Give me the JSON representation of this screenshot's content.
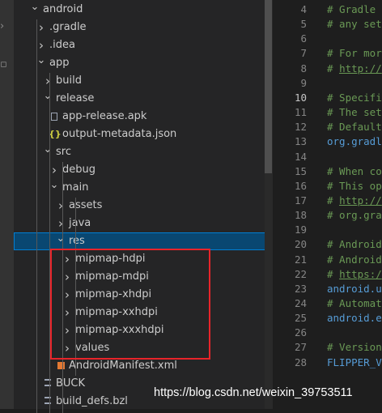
{
  "activity_bar": {
    "icons": [
      "chevron-right-icon",
      "extensions-icon"
    ]
  },
  "explorer": {
    "items": [
      {
        "label": "android",
        "type": "folder",
        "expanded": true
      },
      {
        "label": ".gradle",
        "type": "folder",
        "expanded": false
      },
      {
        "label": ".idea",
        "type": "folder",
        "expanded": false
      },
      {
        "label": "app",
        "type": "folder",
        "expanded": true
      },
      {
        "label": "build",
        "type": "folder",
        "expanded": false
      },
      {
        "label": "release",
        "type": "folder",
        "expanded": true
      },
      {
        "label": "app-release.apk",
        "type": "file"
      },
      {
        "label": "output-metadata.json",
        "type": "file",
        "icon_glyph": "{}"
      },
      {
        "label": "src",
        "type": "folder",
        "expanded": true
      },
      {
        "label": "debug",
        "type": "folder",
        "expanded": false
      },
      {
        "label": "main",
        "type": "folder",
        "expanded": true
      },
      {
        "label": "assets",
        "type": "folder",
        "expanded": false
      },
      {
        "label": "java",
        "type": "folder",
        "expanded": false
      },
      {
        "label": "res",
        "type": "folder",
        "expanded": true,
        "selected": true
      },
      {
        "label": "mipmap-hdpi",
        "type": "folder",
        "expanded": false
      },
      {
        "label": "mipmap-mdpi",
        "type": "folder",
        "expanded": false
      },
      {
        "label": "mipmap-xhdpi",
        "type": "folder",
        "expanded": false
      },
      {
        "label": "mipmap-xxhdpi",
        "type": "folder",
        "expanded": false
      },
      {
        "label": "mipmap-xxxhdpi",
        "type": "folder",
        "expanded": false
      },
      {
        "label": "values",
        "type": "folder",
        "expanded": false
      },
      {
        "label": "AndroidManifest.xml",
        "type": "file"
      },
      {
        "label": "BUCK",
        "type": "file"
      },
      {
        "label": "build_defs.bzl",
        "type": "file"
      }
    ]
  },
  "editor": {
    "current_line": "10",
    "lines": [
      {
        "num": "4",
        "text": "# Gradle",
        "kind": "comment"
      },
      {
        "num": "5",
        "text": "# any set",
        "kind": "comment"
      },
      {
        "num": "6",
        "text": "",
        "kind": "blank"
      },
      {
        "num": "7",
        "text": "# For mor",
        "kind": "comment"
      },
      {
        "num": "8",
        "text": "# http://",
        "kind": "link"
      },
      {
        "num": "9",
        "text": "",
        "kind": "blank"
      },
      {
        "num": "10",
        "text": "# Specifi",
        "kind": "comment"
      },
      {
        "num": "11",
        "text": "# The set",
        "kind": "comment"
      },
      {
        "num": "12",
        "text": "# Default",
        "kind": "comment"
      },
      {
        "num": "13",
        "text": "org.gradl",
        "kind": "key"
      },
      {
        "num": "14",
        "text": "",
        "kind": "blank"
      },
      {
        "num": "15",
        "text": "# When co",
        "kind": "comment"
      },
      {
        "num": "16",
        "text": "# This op",
        "kind": "comment"
      },
      {
        "num": "17",
        "text": "# http://",
        "kind": "link"
      },
      {
        "num": "18",
        "text": "# org.gra",
        "kind": "comment"
      },
      {
        "num": "19",
        "text": "",
        "kind": "blank"
      },
      {
        "num": "20",
        "text": "# Android",
        "kind": "comment"
      },
      {
        "num": "21",
        "text": "# Android",
        "kind": "comment"
      },
      {
        "num": "22",
        "text": "# https:/",
        "kind": "link"
      },
      {
        "num": "23",
        "text": "android.u",
        "kind": "key"
      },
      {
        "num": "24",
        "text": "# Automat",
        "kind": "comment"
      },
      {
        "num": "25",
        "text": "android.e",
        "kind": "key"
      },
      {
        "num": "26",
        "text": "",
        "kind": "blank"
      },
      {
        "num": "27",
        "text": "# Version",
        "kind": "comment"
      },
      {
        "num": "28",
        "text": "FLIPPER_V",
        "kind": "key"
      }
    ]
  },
  "watermark": "https://blog.csdn.net/weixin_39753511",
  "colors": {
    "selection": "#094771",
    "highlight_box": "#e8242a",
    "comment": "#6a9955",
    "key": "#569cd6"
  }
}
